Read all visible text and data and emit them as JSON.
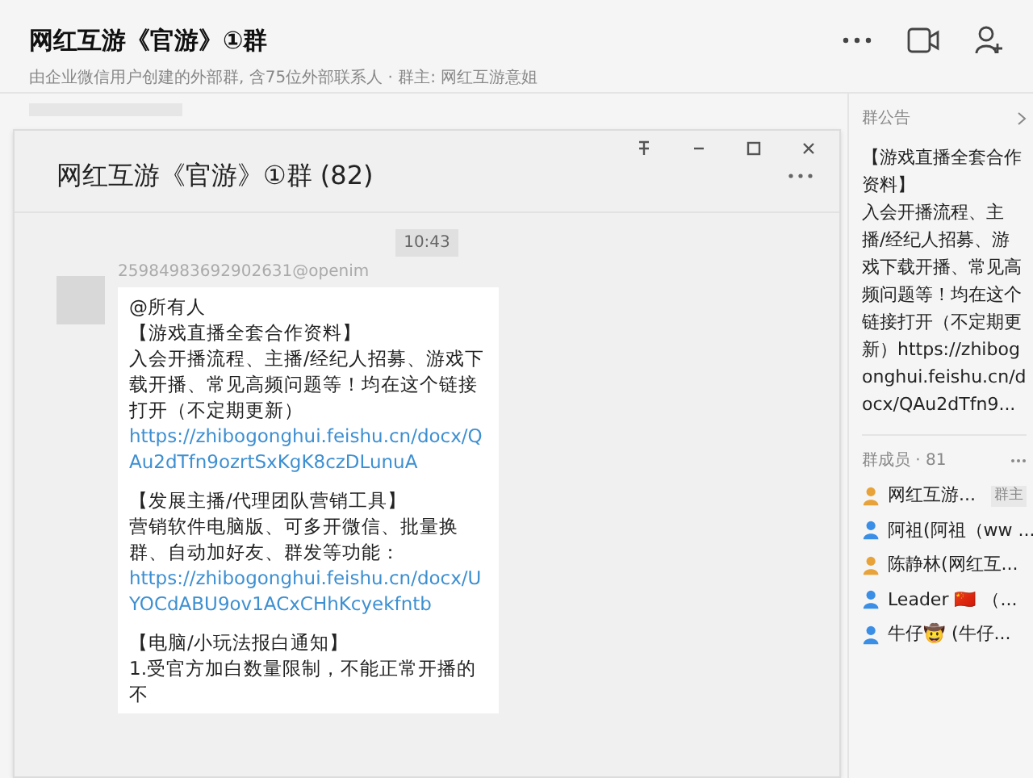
{
  "header": {
    "title": "网红互游《官游》①群",
    "subtitle": "由企业微信用户创建的外部群, 含75位外部联系人 · 群主: 网红互游意姐"
  },
  "popup": {
    "title": "网红互游《官游》①群 (82)",
    "chat": {
      "time": "10:43",
      "message": {
        "sender": "25984983692902631@openim",
        "groups": [
          [
            {
              "text": "@所有人"
            },
            {
              "text": "【游戏直播全套合作资料】"
            },
            {
              "text": "入会开播流程、主播/经纪人招募、游戏下载开播、常见高频问题等！均在这个链接打开（不定期更新）",
              "link": "https://zhibogonghui.feishu.cn/docx/QAu2dTfn9ozrtSxKgK8czDLunuA"
            }
          ],
          [
            {
              "text": "【发展主播/代理团队营销工具】"
            },
            {
              "text": "营销软件电脑版、可多开微信、批量换群、自动加好友、群发等功能：",
              "link": "https://zhibogonghui.feishu.cn/docx/UYOCdABU9ov1ACxCHhKcyekfntb"
            }
          ],
          [
            {
              "text": "【电脑/小玩法报白通知】"
            },
            {
              "text": "1.受官方加白数量限制，不能正常开播的不"
            }
          ]
        ]
      }
    }
  },
  "announcement": {
    "label": "群公告",
    "title": "【游戏直播全套合作资料】",
    "body": "入会开播流程、主播/经纪人招募、游戏下载开播、常见高频问题等！均在这个链接打开（不定期更新）https://zhibogonghui.feishu.cn/docx/QAu2dTfn9..."
  },
  "members": {
    "label": "群成员 · 81",
    "items": [
      {
        "name": "网红互游...",
        "color": "#e8a23a",
        "badge": "群主"
      },
      {
        "name": "阿祖(阿祖（ww ...",
        "color": "#3a8ee6"
      },
      {
        "name": "陈静林(网红互...",
        "color": "#e8a23a"
      },
      {
        "name": "Leader 🇨🇳 （...",
        "color": "#3a8ee6"
      },
      {
        "name": "牛仔🤠 (牛仔...",
        "color": "#3a8ee6"
      }
    ]
  }
}
